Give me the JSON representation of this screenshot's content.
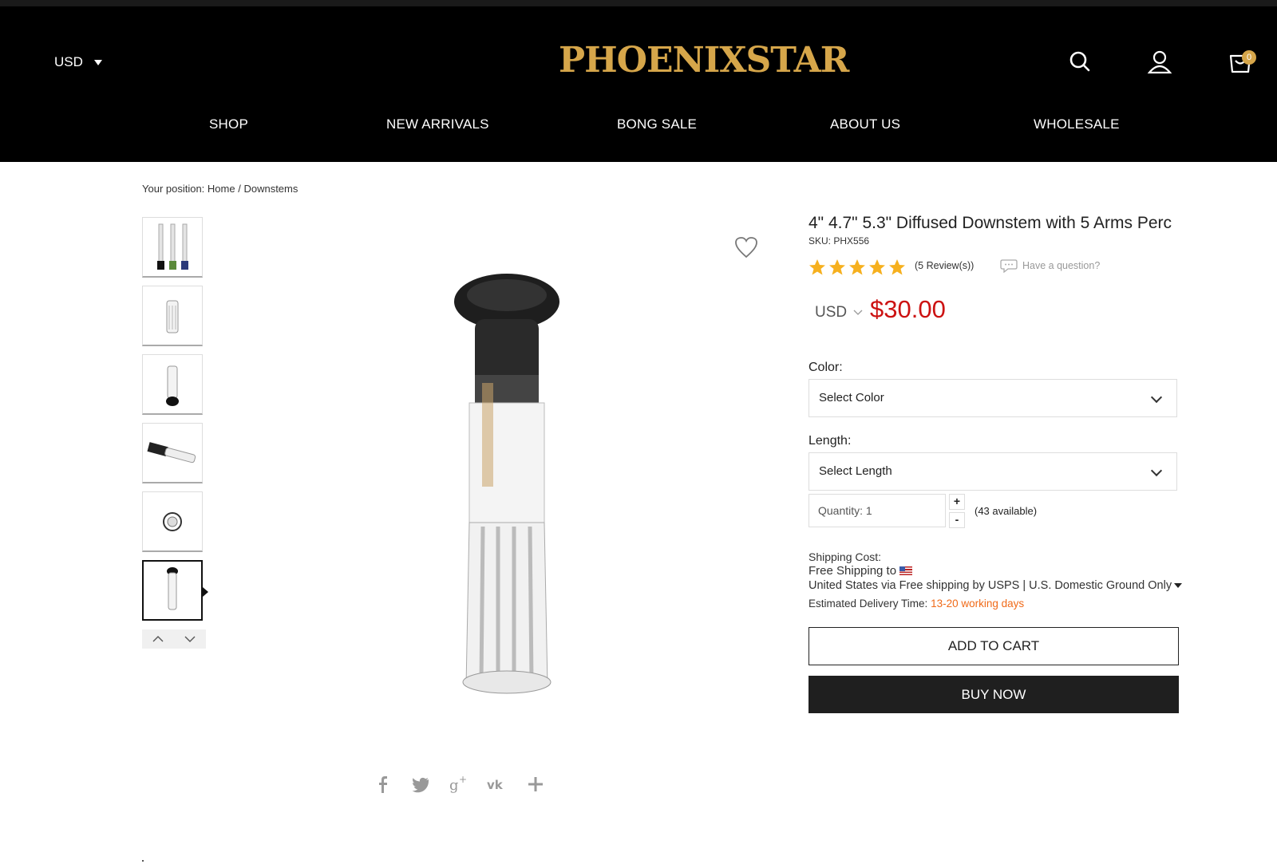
{
  "header": {
    "currency": "USD",
    "logo_text": "PHOENIXSTAR",
    "cart_count": "0",
    "accent_color": "#d6a64a"
  },
  "nav": {
    "items": [
      "SHOP",
      "NEW ARRIVALS",
      "BONG SALE",
      "ABOUT US",
      "WHOLESALE"
    ]
  },
  "breadcrumb": {
    "prefix": "Your position: ",
    "home": "Home",
    "sep": " / ",
    "current": "Downstems"
  },
  "gallery": {
    "thumbnail_count": 6,
    "active_index": 5
  },
  "share": {
    "icons": [
      "facebook-icon",
      "twitter-icon",
      "google-plus-icon",
      "vk-icon",
      "plus-icon"
    ]
  },
  "product": {
    "title": "4\" 4.7\" 5.3\" Diffused Downstem with 5 Arms Perc",
    "sku": "SKU: PHX556",
    "rating": 5,
    "reviews": "(5 Review(s))",
    "question": "Have a question?",
    "price_currency": "USD",
    "price": "$30.00",
    "price_color": "#cc1212"
  },
  "options": {
    "color_label": "Color:",
    "color_value": "Select Color",
    "length_label": "Length:",
    "length_value": "Select Length",
    "quantity_text": "Quantity: 1",
    "plus": "+",
    "minus": "-",
    "available": "(43 available)"
  },
  "shipping": {
    "cost_label": "Shipping Cost:",
    "free_to": "Free Shipping to",
    "method": "United States via Free shipping by USPS | U.S. Domestic Ground Only",
    "eta_label": "Estimated Delivery Time:",
    "eta_value": "13-20 working days"
  },
  "actions": {
    "add_to_cart": "ADD TO CART",
    "buy_now": "BUY NOW"
  }
}
